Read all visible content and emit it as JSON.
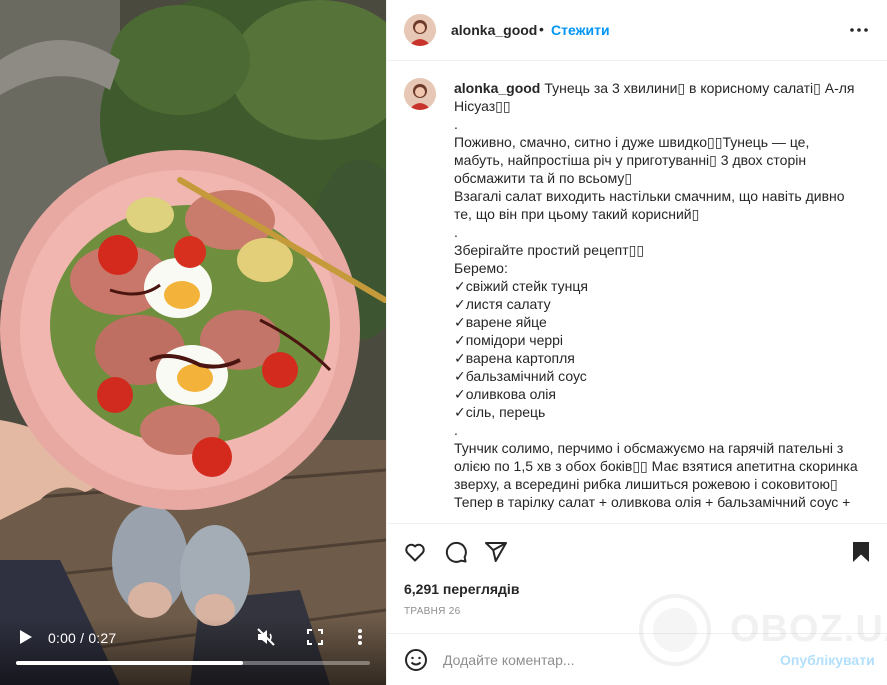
{
  "video": {
    "time": "0:00 / 0:27",
    "progress": 0.64,
    "icons": {
      "play": "play-icon",
      "mute": "muted-speaker-icon",
      "fullscreen": "fullscreen-icon",
      "more": "vertical-dots-icon"
    }
  },
  "header": {
    "username": "alonka_good",
    "separator": "•",
    "follow_label": "Стежити",
    "options_icon": "horizontal-dots-icon"
  },
  "caption": {
    "username": "alonka_good",
    "lines": [
      "Тунець за 3 хвилини▯ в корисному салаті▯ А-ля Нісуаз▯▯",
      ".",
      "Поживно, смачно, ситно і дуже швидко▯▯Тунець — це, мабуть, найпростіша річ у приготуванні▯ 3 двох сторін обсмажити та й по всьому▯",
      "Взагалі салат виходить настільки смачним, що навіть дивно те, що він при цьому такий корисний▯",
      ".",
      "Зберігайте простий рецепт▯▯",
      "Беремо:",
      "✓свіжий стейк тунця",
      "✓листя салату",
      "✓варене яйце",
      "✓помідори черрі",
      "✓варена картопля",
      "✓бальзамічний соус",
      "✓оливкова олія",
      "✓сіль, перець",
      ".",
      "Тунчик солимо, перчимо і обсмажуємо на гарячій пательні з олією по 1,5 хв з обох боків▯▯ Має взятися апетитна скоринка зверху, а всередині рибка лишиться рожевою і соковитою▯",
      "Тепер в тарілку салат + оливкова олія + бальзамічний соус +"
    ]
  },
  "actions": {
    "icons": [
      "heart-icon",
      "comment-icon",
      "share-icon",
      "bookmark-icon"
    ],
    "views": "6,291 переглядів",
    "date": "ТРАВНЯ 26"
  },
  "comment": {
    "placeholder": "Додайте коментар...",
    "publish_label": "Опублікувати",
    "emoji_icon": "emoji-icon"
  },
  "watermark": {
    "text": "OBOZ.UA"
  },
  "colors": {
    "link_blue": "#0095f6",
    "publish_disabled": "#b2dffc",
    "border": "#efefef",
    "muted": "#8e8e8e"
  }
}
